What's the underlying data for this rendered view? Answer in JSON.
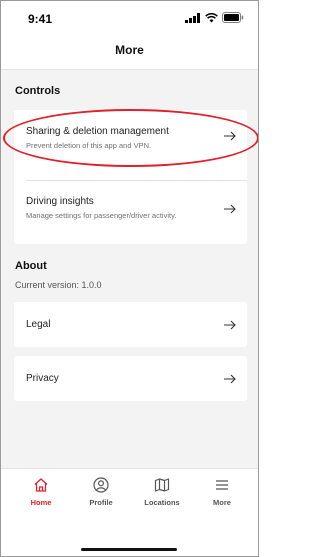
{
  "status": {
    "time": "9:41"
  },
  "header": {
    "title": "More"
  },
  "controls": {
    "title": "Controls",
    "items": [
      {
        "title": "Sharing & deletion management",
        "subtitle": "Prevent deletion of this app and VPN."
      },
      {
        "title": "Driving insights",
        "subtitle": "Manage settings for passenger/driver activity."
      }
    ]
  },
  "about": {
    "title": "About",
    "version": "Current version: 1.0.0",
    "items": [
      {
        "title": "Legal"
      },
      {
        "title": "Privacy"
      }
    ]
  },
  "tabs": [
    {
      "label": "Home",
      "icon": "home-icon",
      "active": true
    },
    {
      "label": "Profile",
      "icon": "profile-icon"
    },
    {
      "label": "Locations",
      "icon": "map-icon"
    },
    {
      "label": "More",
      "icon": "menu-icon"
    }
  ],
  "colors": {
    "accent": "#e0202a",
    "background": "#f3f3f3"
  }
}
